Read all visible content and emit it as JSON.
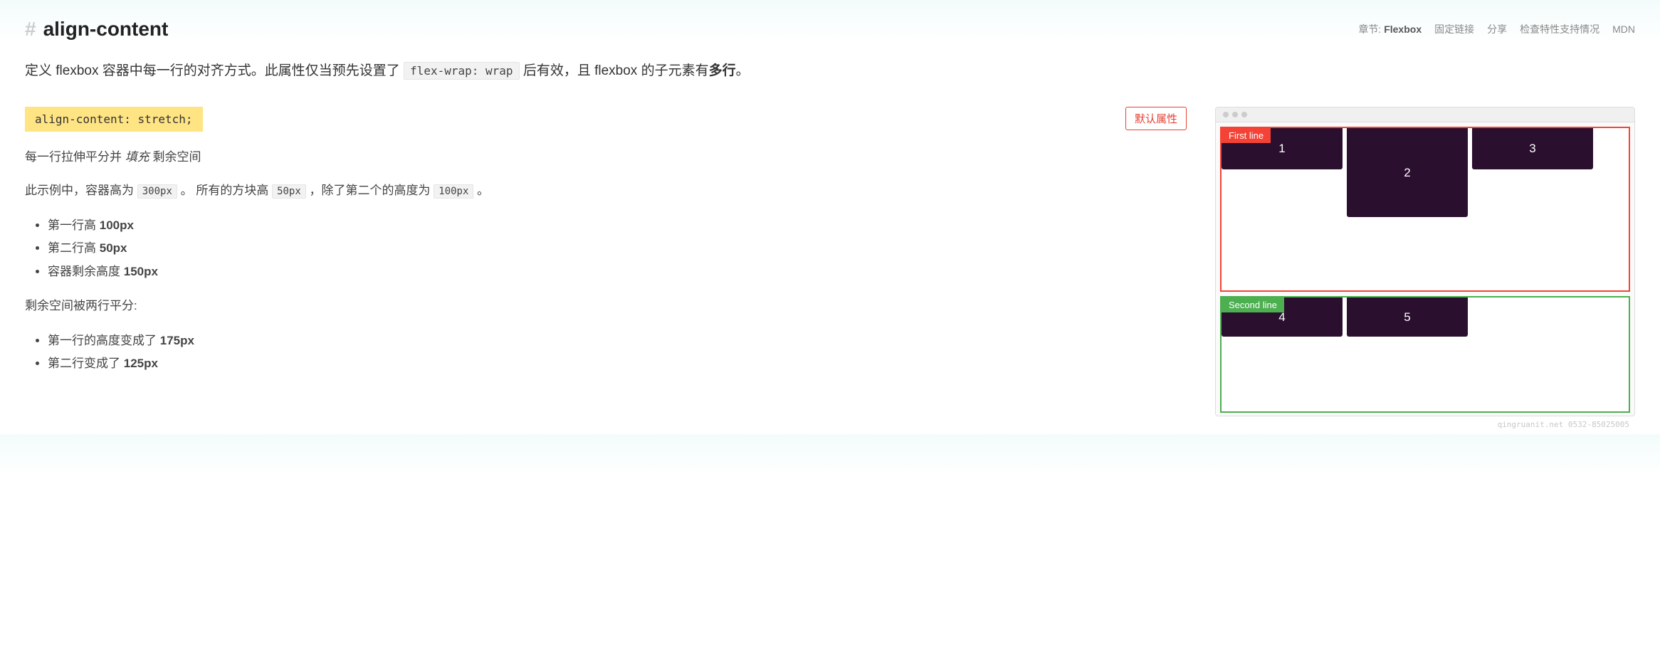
{
  "header": {
    "title": "align-content",
    "chapter_prefix": "章节: ",
    "chapter_name": "Flexbox",
    "links": {
      "permalink": "固定链接",
      "share": "分享",
      "compat": "检查特性支持情况",
      "mdn": "MDN"
    }
  },
  "intro": {
    "text_before_code": "定义 flexbox 容器中每一行的对齐方式。此属性仅当预先设置了 ",
    "code": "flex-wrap: wrap",
    "text_after_code": " 后有效，且 flexbox 的子元素有",
    "strong": "多行",
    "suffix": "。"
  },
  "property": {
    "code": "align-content: stretch;",
    "default_badge": "默认属性"
  },
  "description": {
    "line1_a": "每一行拉伸平分并 ",
    "line1_em": "填充",
    "line1_b": " 剩余空间",
    "line2_a": "此示例中，容器高为 ",
    "line2_code1": "300px",
    "line2_b": " 。 所有的方块高 ",
    "line2_code2": "50px",
    "line2_c": " ，除了第二个的高度为 ",
    "line2_code3": "100px",
    "line2_d": " 。"
  },
  "list1": {
    "item1_a": "第一行高 ",
    "item1_b": "100px",
    "item2_a": "第二行高 ",
    "item2_b": "50px",
    "item3_a": "容器剩余高度 ",
    "item3_b": "150px"
  },
  "mid_text": "剩余空间被两行平分:",
  "list2": {
    "item1_a": "第一行的高度变成了 ",
    "item1_b": "175px",
    "item2_a": "第二行变成了 ",
    "item2_b": "125px"
  },
  "demo": {
    "first_label": "First line",
    "second_label": "Second line",
    "boxes_first": {
      "b1": "1",
      "b2": "2",
      "b3": "3"
    },
    "boxes_second": {
      "b4": "4",
      "b5": "5"
    }
  },
  "watermark": "qingruanit.net 0532-85025005"
}
